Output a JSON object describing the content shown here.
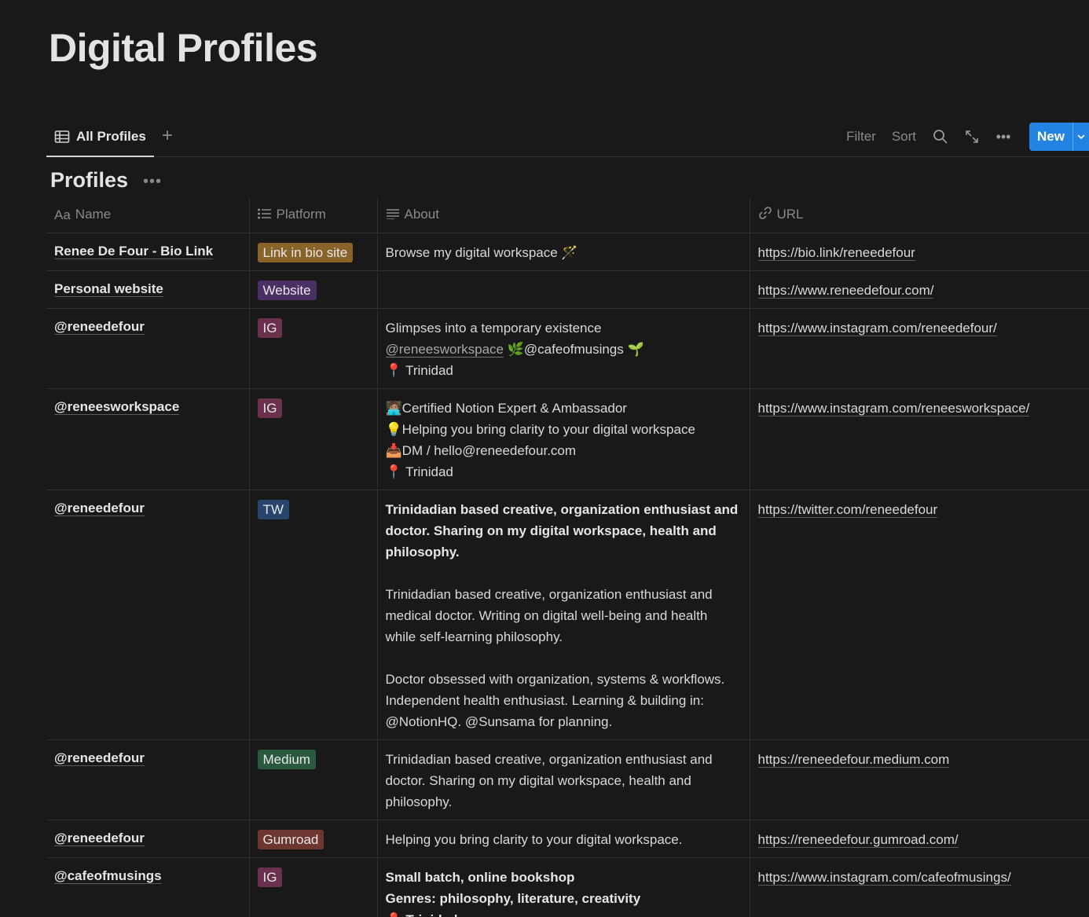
{
  "page": {
    "title": "Digital Profiles"
  },
  "view": {
    "tab_label": "All Profiles",
    "tools": {
      "filter": "Filter",
      "sort": "Sort",
      "new": "New"
    }
  },
  "group": {
    "title": "Profiles"
  },
  "columns": {
    "name": "Name",
    "platform": "Platform",
    "about": "About",
    "url": "URL"
  },
  "rows": [
    {
      "name": "Renee De Four - Bio Link",
      "platform": "Link in bio site",
      "tag_color": "#89632a",
      "about": "Browse my digital workspace 🪄",
      "url": "https://bio.link/reneedefour"
    },
    {
      "name": "Personal website",
      "platform": "Website",
      "tag_color": "#492f64",
      "about": "",
      "url": "https://www.reneedefour.com/"
    },
    {
      "name": "@reneedefour",
      "platform": "IG",
      "tag_color": "#69314c",
      "about_line1": "Glimpses into a temporary existence",
      "about_mention": "@reneesworkspace",
      "about_line2b": " 🌿@cafeofmusings 🌱",
      "about_line3": "📍 Trinidad",
      "url": "https://www.instagram.com/reneedefour/"
    },
    {
      "name": "@reneesworkspace",
      "platform": "IG",
      "tag_color": "#69314c",
      "about": "🧑🏽‍💻Certified Notion Expert & Ambassador\n💡Helping you bring clarity to your digital workspace\n📥DM / hello@reneedefour.com\n📍 Trinidad",
      "url": "https://www.instagram.com/reneesworkspace/"
    },
    {
      "name": "@reneedefour",
      "platform": "TW",
      "tag_color": "#28456c",
      "about_bold": "Trinidadian based creative, organization enthusiast and doctor. Sharing on my digital workspace, health and philosophy.",
      "about_p2": "Trinidadian based creative, organization enthusiast and medical doctor. Writing on digital well-being and health while self-learning philosophy.",
      "about_p3": "Doctor obsessed with organization, systems & workflows. Independent health enthusiast. Learning & building in: @NotionHQ. @Sunsama for planning.",
      "url": "https://twitter.com/reneedefour"
    },
    {
      "name": "@reneedefour",
      "platform": "Medium",
      "tag_color": "#2b593f",
      "about": "Trinidadian based creative, organization enthusiast and doctor. Sharing on my digital workspace, health and philosophy.",
      "url": "https://reneedefour.medium.com"
    },
    {
      "name": "@reneedefour",
      "platform": "Gumroad",
      "tag_color": "#6e3630",
      "about": "Helping you bring clarity to your digital workspace.",
      "url": "https://reneedefour.gumroad.com/"
    },
    {
      "name": "@cafeofmusings",
      "platform": "IG",
      "tag_color": "#69314c",
      "about_bold": "Small batch, online bookshop\nGenres: philosophy, literature, creativity\n📍 Trinidad",
      "url": "https://www.instagram.com/cafeofmusings/"
    }
  ]
}
